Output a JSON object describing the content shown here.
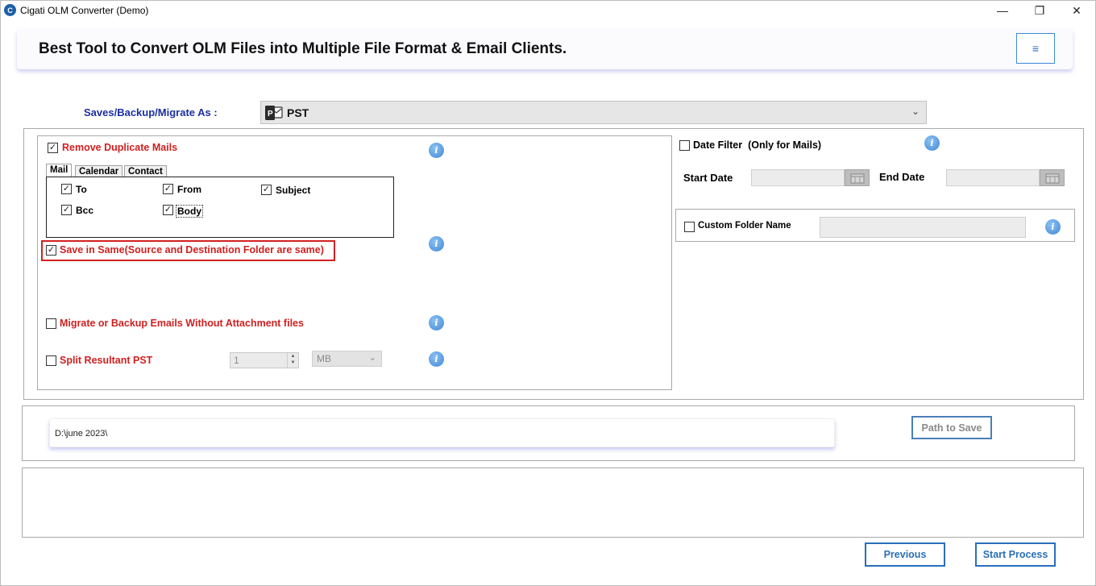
{
  "window": {
    "title": "Cigati OLM Converter (Demo)",
    "icon_letter": "C",
    "controls": {
      "minimize": "—",
      "maximize": "❐",
      "close": "✕"
    }
  },
  "banner": {
    "title": "Best Tool to Convert OLM Files into Multiple File Format & Email Clients.",
    "menu_icon": "≡"
  },
  "saveas": {
    "label": "Saves/Backup/Migrate As :",
    "selected": "PST",
    "icon_letter": "P"
  },
  "options": {
    "remove_duplicate": {
      "label": "Remove Duplicate Mails",
      "checked": true
    },
    "tabs": [
      {
        "label": "Mail",
        "active": true
      },
      {
        "label": "Calendar",
        "active": false
      },
      {
        "label": "Contact",
        "active": false
      }
    ],
    "mail_fields": [
      {
        "label": "To",
        "checked": true
      },
      {
        "label": "From",
        "checked": true
      },
      {
        "label": "Subject",
        "checked": true
      },
      {
        "label": "Bcc",
        "checked": true
      },
      {
        "label": "Body",
        "checked": true
      }
    ],
    "save_in_same": {
      "label": "Save in Same(Source and Destination Folder are same)",
      "checked": true
    },
    "without_attachment": {
      "label": "Migrate or Backup Emails Without Attachment files",
      "checked": false
    },
    "split": {
      "label": "Split Resultant PST",
      "checked": false,
      "value": "1",
      "unit": "MB"
    },
    "info_glyph": "i"
  },
  "date_filter": {
    "label": "Date Filter",
    "note": "(Only for Mails)",
    "checked": false,
    "start_label": "Start Date",
    "end_label": "End Date"
  },
  "custom_folder": {
    "label": "Custom Folder Name",
    "checked": false
  },
  "path": {
    "value": "D:\\june 2023\\",
    "button": "Path to Save"
  },
  "footer": {
    "previous": "Previous",
    "start": "Start Process"
  },
  "colors": {
    "accent_blue": "#2a6fb8",
    "label_red": "#d02020",
    "label_navy": "#1b2fa0"
  }
}
